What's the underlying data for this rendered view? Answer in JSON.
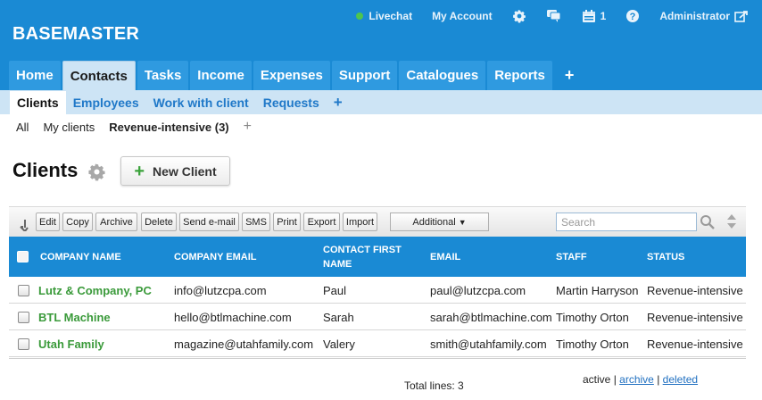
{
  "brand": "BASEMASTER",
  "topbar": {
    "livechat": "Livechat",
    "my_account": "My Account",
    "tasks_count": "1",
    "user": "Administrator"
  },
  "main_tabs": [
    "Home",
    "Contacts",
    "Tasks",
    "Income",
    "Expenses",
    "Support",
    "Catalogues",
    "Reports",
    "+"
  ],
  "sub_tabs": [
    "Clients",
    "Employees",
    "Work with client",
    "Requests",
    "+"
  ],
  "filters": [
    "All",
    "My clients",
    "Revenue-intensive (3)",
    "+"
  ],
  "page": {
    "title": "Clients",
    "new_button": "New Client"
  },
  "toolbar": {
    "buttons": [
      "Edit",
      "Copy",
      "Archive",
      "Delete",
      "Send e-mail",
      "SMS",
      "Print",
      "Export",
      "Import"
    ],
    "additional": "Additional",
    "search_placeholder": "Search"
  },
  "table": {
    "columns": [
      "COMPANY NAME",
      "COMPANY EMAIL",
      "CONTACT FIRST NAME",
      "EMAIL",
      "STAFF",
      "STATUS"
    ],
    "rows": [
      {
        "company": "Lutz & Company, PC",
        "company_email": "info@lutzcpa.com",
        "first_name": "Paul",
        "email": "paul@lutzcpa.com",
        "staff": "Martin Harryson",
        "status": "Revenue-intensive"
      },
      {
        "company": "BTL Machine",
        "company_email": "hello@btlmachine.com",
        "first_name": "Sarah",
        "email": "sarah@btlmachine.com",
        "staff": "Timothy Orton",
        "status": "Revenue-intensive"
      },
      {
        "company": "Utah Family",
        "company_email": "magazine@utahfamily.com",
        "first_name": "Valery",
        "email": "smith@utahfamily.com",
        "staff": "Timothy Orton",
        "status": "Revenue-intensive"
      }
    ]
  },
  "footer": {
    "total": "Total lines: 3",
    "active": "active",
    "sep": "|",
    "archive": "archive",
    "deleted": "deleted"
  },
  "colors": {
    "header_blue": "#1a8ad4",
    "company_green": "#3a9a3a",
    "subtab_bg": "#cde4f5"
  }
}
